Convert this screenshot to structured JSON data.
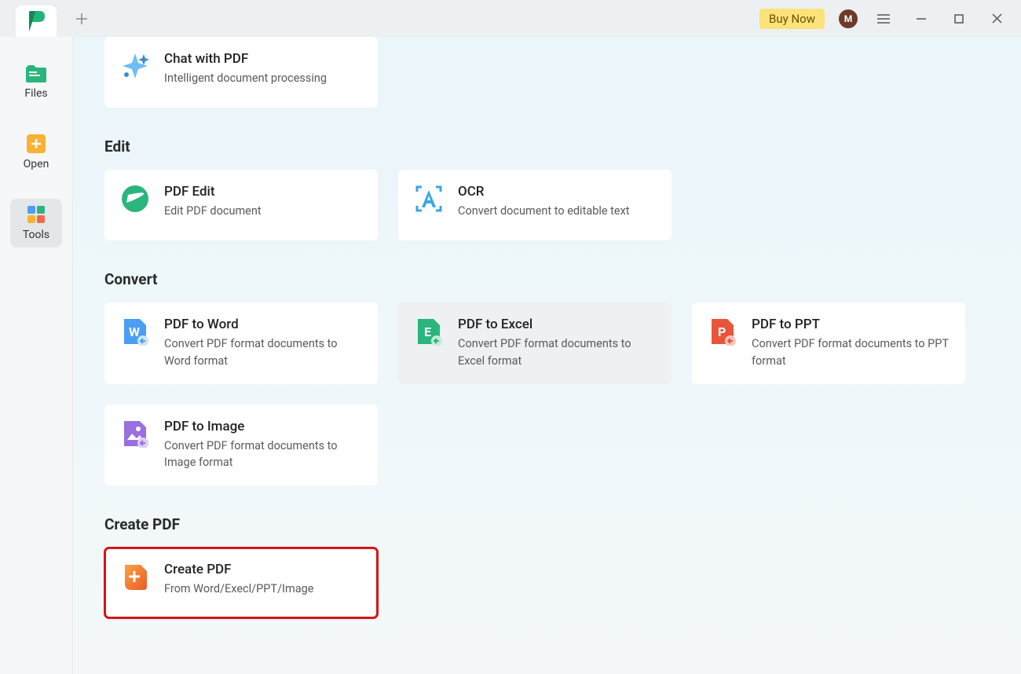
{
  "titlebar": {
    "buy_now": "Buy Now",
    "avatar_letter": "M"
  },
  "sidebar": {
    "items": [
      {
        "label": "Files"
      },
      {
        "label": "Open"
      },
      {
        "label": "Tools"
      }
    ]
  },
  "top_card": {
    "title": "Chat with PDF",
    "desc": "Intelligent document processing"
  },
  "sections": {
    "edit": {
      "title": "Edit",
      "cards": [
        {
          "title": "PDF Edit",
          "desc": "Edit PDF document"
        },
        {
          "title": "OCR",
          "desc": "Convert document to editable text"
        }
      ]
    },
    "convert": {
      "title": "Convert",
      "cards": [
        {
          "title": "PDF to Word",
          "desc": "Convert PDF format documents to Word format"
        },
        {
          "title": "PDF to Excel",
          "desc": "Convert PDF format documents to Excel format"
        },
        {
          "title": "PDF to PPT",
          "desc": "Convert PDF format documents to PPT format"
        },
        {
          "title": "PDF to Image",
          "desc": "Convert PDF format documents to Image format"
        }
      ]
    },
    "create": {
      "title": "Create PDF",
      "cards": [
        {
          "title": "Create PDF",
          "desc": "From Word/Execl/PPT/Image"
        }
      ]
    }
  }
}
